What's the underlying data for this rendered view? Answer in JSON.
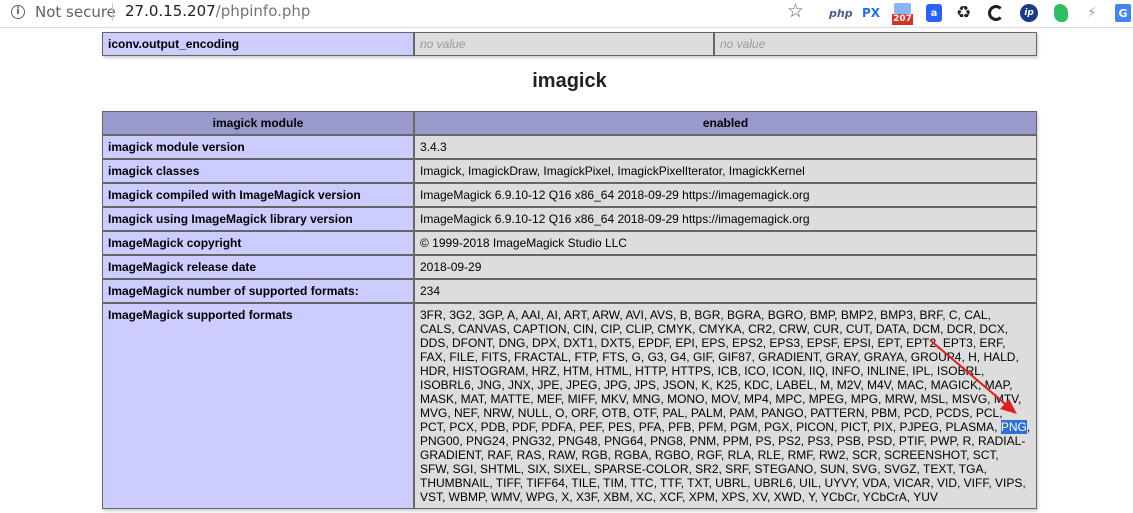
{
  "browser": {
    "security_label": "Not secure",
    "url_host": "27.0.15.207",
    "url_path": "/phpinfo.php",
    "extensions": {
      "php_label": "php",
      "px_label": "PX",
      "mail_badge": "207",
      "amazon_label": "a",
      "ip_label": "ip",
      "google_label": "G"
    }
  },
  "iconv_row": {
    "label": "iconv.output_encoding",
    "local_value": "no value",
    "master_value": "no value"
  },
  "section": {
    "title": "imagick"
  },
  "table": {
    "header_left": "imagick module",
    "header_right": "enabled",
    "rows": [
      {
        "label": "imagick module version",
        "value": "3.4.3"
      },
      {
        "label": "imagick classes",
        "value": "Imagick, ImagickDraw, ImagickPixel, ImagickPixelIterator, ImagickKernel"
      },
      {
        "label": "Imagick compiled with ImageMagick version",
        "value": "ImageMagick 6.9.10-12 Q16 x86_64 2018-09-29 https://imagemagick.org"
      },
      {
        "label": "Imagick using ImageMagick library version",
        "value": "ImageMagick 6.9.10-12 Q16 x86_64 2018-09-29 https://imagemagick.org"
      },
      {
        "label": "ImageMagick copyright",
        "value": "© 1999-2018 ImageMagick Studio LLC"
      },
      {
        "label": "ImageMagick release date",
        "value": "2018-09-29"
      },
      {
        "label": "ImageMagick number of supported formats:",
        "value": "234"
      }
    ],
    "formats_label": "ImageMagick supported formats",
    "formats_before": "3FR, 3G2, 3GP, A, AAI, AI, ART, ARW, AVI, AVS, B, BGR, BGRA, BGRO, BMP, BMP2, BMP3, BRF, C, CAL,\nCALS, CANVAS, CAPTION, CIN, CIP, CLIP, CMYK, CMYKA, CR2, CRW, CUR, CUT, DATA, DCM, DCR, DCX,\nDDS, DFONT, DNG, DPX, DXT1, DXT5, EPDF, EPI, EPS, EPS2, EPS3, EPSF, EPSI, EPT, EPT2, EPT3, ERF,\nFAX, FILE, FITS, FRACTAL, FTP, FTS, G, G3, G4, GIF, GIF87, GRADIENT, GRAY, GRAYA, GROUP4, H, HALD,\nHDR, HISTOGRAM, HRZ, HTM, HTML, HTTP, HTTPS, ICB, ICO, ICON, IIQ, INFO, INLINE, IPL, ISOBRL,\nISOBRL6, JNG, JNX, JPE, JPEG, JPG, JPS, JSON, K, K25, KDC, LABEL, M, M2V, M4V, MAC, MAGICK, MAP,\nMASK, MAT, MATTE, MEF, MIFF, MKV, MNG, MONO, MOV, MP4, MPC, MPEG, MPG, MRW, MSL, MSVG, MTV,\nMVG, NEF, NRW, NULL, O, ORF, OTB, OTF, PAL, PALM, PAM, PANGO, PATTERN, PBM, PCD, PCDS, PCL,\nPCT, PCX, PDB, PDF, PDFA, PEF, PES, PFA, PFB, PFM, PGM, PGX, PICON, PICT, PIX, PJPEG, PLASMA, ",
    "formats_highlight": "PNG",
    "formats_after": ",\nPNG00, PNG24, PNG32, PNG48, PNG64, PNG8, PNM, PPM, PS, PS2, PS3, PSB, PSD, PTIF, PWP, R, RADIAL-\nGRADIENT, RAF, RAS, RAW, RGB, RGBA, RGBO, RGF, RLA, RLE, RMF, RW2, SCR, SCREENSHOT, SCT,\nSFW, SGI, SHTML, SIX, SIXEL, SPARSE-COLOR, SR2, SRF, STEGANO, SUN, SVG, SVGZ, TEXT, TGA,\nTHUMBNAIL, TIFF, TIFF64, TILE, TIM, TTC, TTF, TXT, UBRL, UBRL6, UIL, UYVY, VDA, VICAR, VID, VIFF, VIPS,\nVST, WBMP, WMV, WPG, X, X3F, XBM, XC, XCF, XPM, XPS, XV, XWD, Y, YCbCr, YCbCrA, YUV"
  },
  "colors": {
    "header_bg": "#9999cc",
    "label_bg": "#ccccff",
    "value_bg": "#dddddd",
    "selection": "#2f6fd6",
    "annotation_arrow": "#e02020"
  }
}
